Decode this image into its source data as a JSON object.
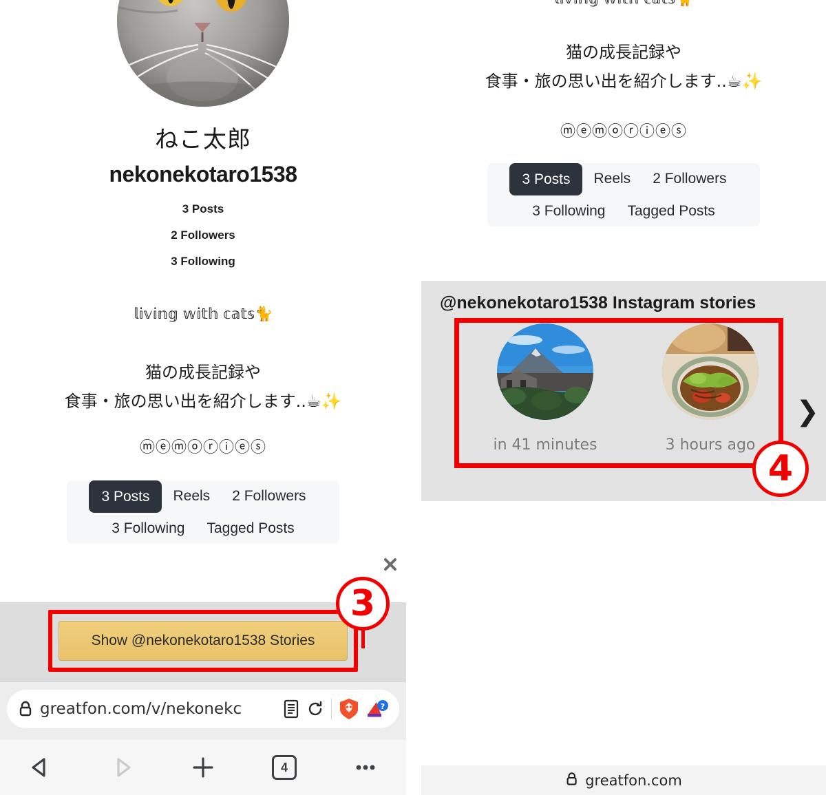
{
  "profile": {
    "display_name": "ねこ太郎",
    "handle": "nekonekotaro1538",
    "posts": "3 Posts",
    "followers": "2 Followers",
    "following": "3 Following",
    "bio_fancy": "𝕝𝕚𝕧𝕚𝕟𝕘 𝕨𝕚𝕥𝕙 𝕔𝕒𝕥𝕤🐈",
    "bio_line1": "猫の成長記録や",
    "bio_line2": "食事・旅の思い出を紹介します..☕✨",
    "bio_memories": "ⓜⓔⓜⓞⓡⓘⓔⓢ",
    "avatar_alt": "gray-tabby-cat-face"
  },
  "tabs": {
    "row1": [
      "3 Posts",
      "Reels",
      "2 Followers"
    ],
    "row2": [
      "3 Following",
      "Tagged Posts"
    ],
    "active": "3 Posts"
  },
  "left_panel": {
    "show_stories_button": "Show @nekonekotaro1538 Stories",
    "annotation_number": "3",
    "close_label": "✕"
  },
  "right_panel": {
    "stories_heading": "@nekonekotaro1538 Instagram stories",
    "annotation_number": "4",
    "next_arrow": "❯",
    "close_label": "✕",
    "stories": [
      {
        "time": "in 41 minutes",
        "thumb_alt": "mt-fuji-landscape-thumbnail"
      },
      {
        "time": "3 hours ago",
        "thumb_alt": "food-bowl-thumbnail"
      }
    ],
    "photo_alt": "mt-fuji-with-trees-and-houses",
    "domain": "greatfon.com"
  },
  "browser": {
    "url": "greatfon.com/v/nekonekc",
    "lock_icon": "lock-icon",
    "reader_icon": "reader-mode-icon",
    "reload_icon": "reload-icon",
    "brave_icon": "brave-shield-icon",
    "extension_icon": "extension-icon",
    "nav": {
      "back": "back-arrow",
      "forward": "forward-arrow",
      "new_tab": "plus-icon",
      "tab_count": "4",
      "menu": "more-options-icon"
    }
  },
  "colors": {
    "accent_red": "#f20000",
    "yellow_button": "#ebc86d",
    "tab_active_bg": "#2c333d",
    "stories_bg": "#e3e3e3"
  }
}
